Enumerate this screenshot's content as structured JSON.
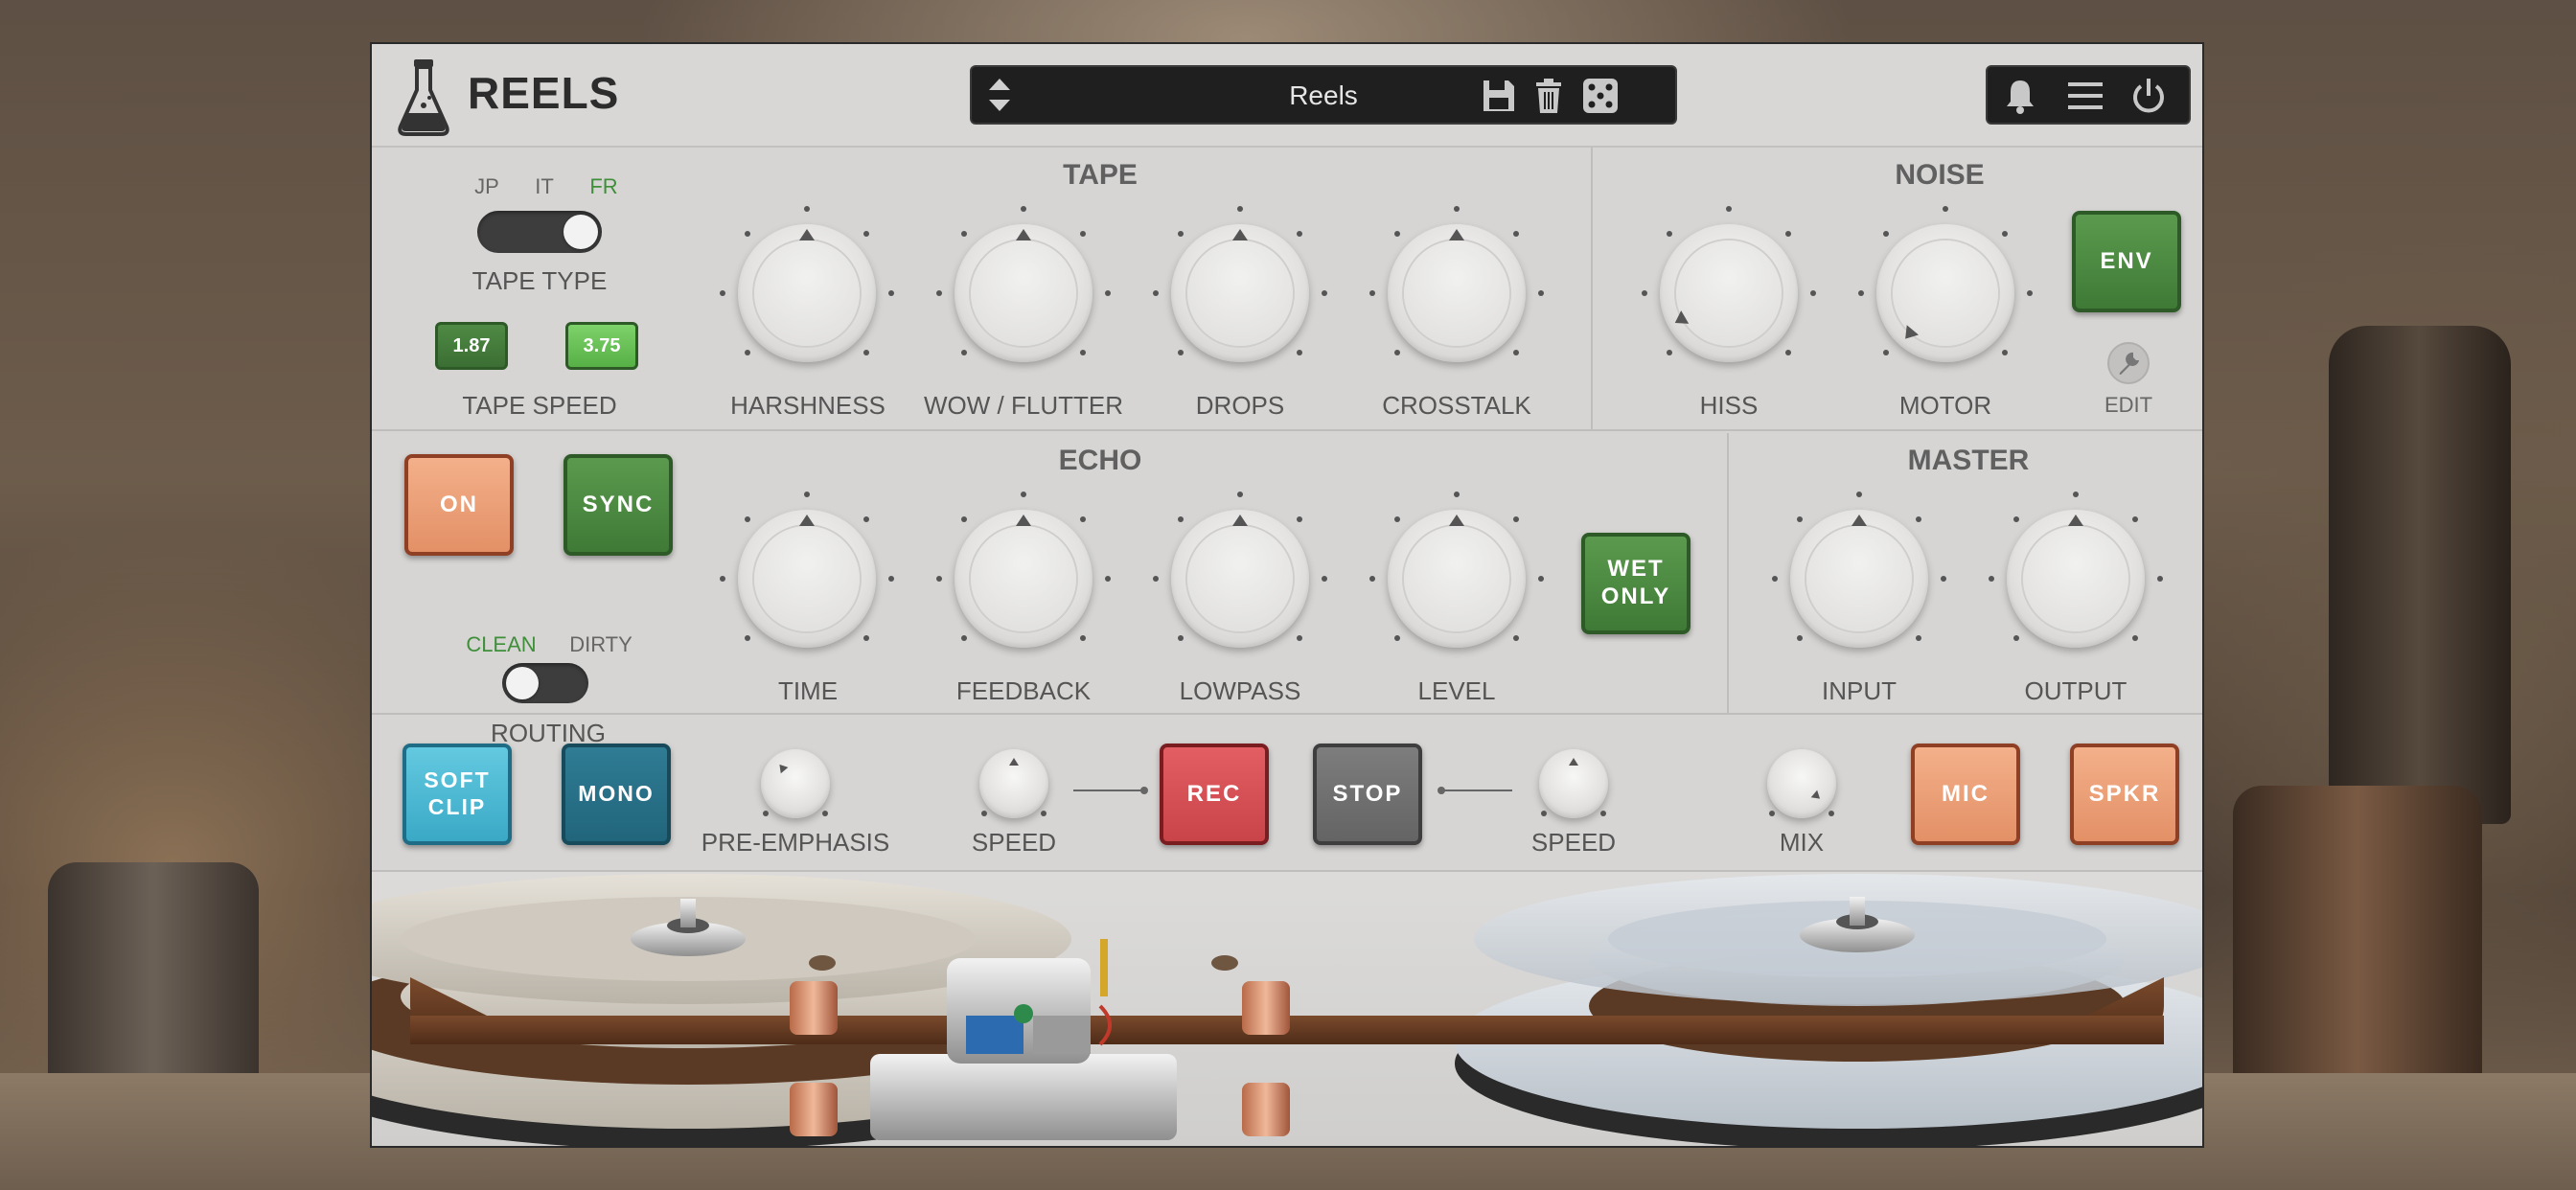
{
  "header": {
    "brand": "REELS",
    "preset_name": "Reels"
  },
  "tape": {
    "title": "TAPE",
    "tape_type": {
      "options": [
        "JP",
        "IT",
        "FR"
      ],
      "selected": "FR",
      "label": "TAPE TYPE"
    },
    "tape_speed": {
      "options": [
        "1.87",
        "3.75"
      ],
      "selected": "3.75",
      "label": "TAPE SPEED"
    },
    "knobs": [
      "HARSHNESS",
      "WOW / FLUTTER",
      "DROPS",
      "CROSSTALK"
    ]
  },
  "noise": {
    "title": "NOISE",
    "knobs": [
      "HISS",
      "MOTOR"
    ],
    "env_button": "ENV",
    "edit_label": "EDIT"
  },
  "echo": {
    "title": "ECHO",
    "on_button": "ON",
    "sync_button": "SYNC",
    "routing": {
      "options": [
        "CLEAN",
        "DIRTY"
      ],
      "selected": "CLEAN",
      "label": "ROUTING"
    },
    "knobs": [
      "TIME",
      "FEEDBACK",
      "LOWPASS",
      "LEVEL"
    ],
    "wet_only_button": [
      "WET",
      "ONLY"
    ]
  },
  "master": {
    "title": "MASTER",
    "knobs": [
      "INPUT",
      "OUTPUT"
    ]
  },
  "bottom": {
    "soft_clip_button": [
      "SOFT",
      "CLIP"
    ],
    "mono_button": "MONO",
    "pre_emphasis_label": "PRE-EMPHASIS",
    "speed_left_label": "SPEED",
    "rec_button": "REC",
    "stop_button": "STOP",
    "speed_right_label": "SPEED",
    "mix_label": "MIX",
    "mic_button": "MIC",
    "spkr_button": "SPKR"
  },
  "colors": {
    "panel": "#d6d5d3",
    "green_button": "#4a8a40",
    "orange_button": "#ea9c74",
    "cyan_button": "#4bb8d3",
    "teal_button": "#27708a",
    "red_button": "#d24f53",
    "grey_button": "#6e6e6e",
    "green_text": "#3f8f3a"
  }
}
